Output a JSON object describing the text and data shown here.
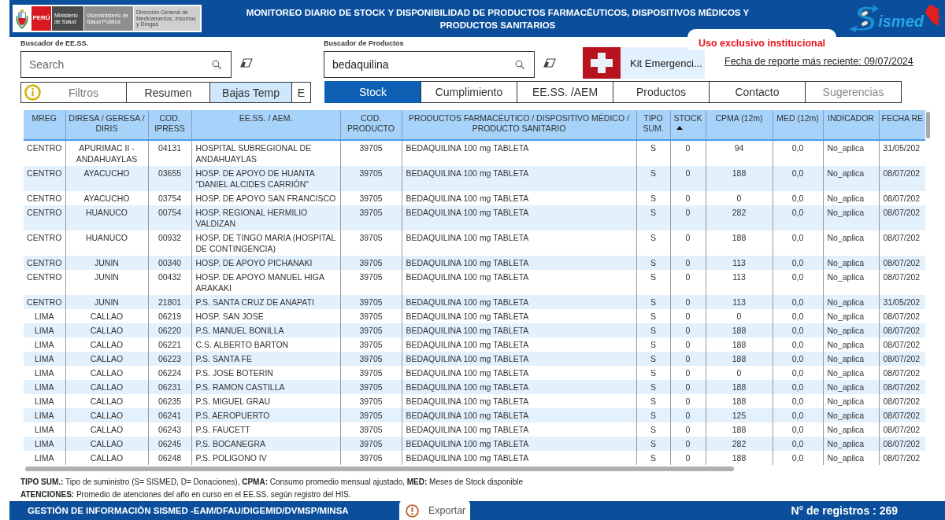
{
  "header": {
    "emblem": {
      "country": "PERÚ",
      "ministry": "Ministerio de Salud",
      "vice_ministry": "Viceministerio de Salud Pública",
      "directorate": "Dirección General de Medicamentos, Insumos y Drogas"
    },
    "title": "MONITOREO DIARIO DE STOCK Y DISPONIBILIDAD DE PRODUCTOS FARMACÉUTICOS, DISPOSITIVOS MÉDICOS Y PRODUCTOS SANITARIOS",
    "brand": "ismed"
  },
  "notice": "Uso exclusivo institucional",
  "facility_search": {
    "label": "Buscador de EE.SS.",
    "placeholder": "Search"
  },
  "product_search": {
    "label": "Buscador de Productos",
    "value": "bedaquilina"
  },
  "kit_button": "Kit Emergenci...",
  "report_date": "Fecha de reporte más reciente: 09/07/2024",
  "side_tabs": [
    {
      "label": "Filtros",
      "kind": "info",
      "selected": false,
      "disabled": true
    },
    {
      "label": "Resumen",
      "kind": "plain",
      "selected": false,
      "disabled": false
    },
    {
      "label": "Bajas Temp",
      "kind": "plain",
      "selected": true,
      "disabled": false
    },
    {
      "label": "E",
      "kind": "plain",
      "selected": false,
      "disabled": false
    }
  ],
  "main_tabs": [
    {
      "label": "Stock",
      "selected": true,
      "disabled": false
    },
    {
      "label": "Cumplimiento",
      "selected": false,
      "disabled": false
    },
    {
      "label": "EE.SS. /AEM",
      "selected": false,
      "disabled": false
    },
    {
      "label": "Productos",
      "selected": false,
      "disabled": false
    },
    {
      "label": "Contacto",
      "selected": false,
      "disabled": false
    },
    {
      "label": "Sugerencias",
      "selected": false,
      "disabled": true
    }
  ],
  "table": {
    "columns": [
      {
        "label": "MREG",
        "sorted": false
      },
      {
        "label": "DIRESA / GERESA / DIRIS",
        "sorted": false
      },
      {
        "label": "COD. IPRESS",
        "sorted": false
      },
      {
        "label": "EE.SS. / AEM.",
        "sorted": false
      },
      {
        "label": "COD. PRODUCTO",
        "sorted": false
      },
      {
        "label": "PRODUCTOS FARMACÉUTICO / DISPOSITIVO MÉDICO / PRODUCTO SANITARIO",
        "sorted": false
      },
      {
        "label": "TIPO SUM.",
        "sorted": false
      },
      {
        "label": "STOCK",
        "sorted": true
      },
      {
        "label": "CPMA (12m)",
        "sorted": false
      },
      {
        "label": "MED (12m)",
        "sorted": false
      },
      {
        "label": "INDICADOR",
        "sorted": false
      },
      {
        "label": "FECHA RE",
        "sorted": false
      }
    ],
    "rows": [
      [
        "CENTRO",
        "APURIMAC II - ANDAHUAYLAS",
        "04131",
        "HOSPITAL SUBREGIONAL DE ANDAHUAYLAS",
        "39705",
        "BEDAQUILINA 100 mg TABLETA",
        "S",
        "0",
        "94",
        "0,0",
        "No_aplica",
        "31/05/202"
      ],
      [
        "CENTRO",
        "AYACUCHO",
        "03655",
        "HOSP. DE APOYO DE HUANTA \"DANIEL ALCIDES CARRIÓN\"",
        "39705",
        "BEDAQUILINA 100 mg TABLETA",
        "S",
        "0",
        "188",
        "0,0",
        "No_aplica",
        "08/07/202"
      ],
      [
        "CENTRO",
        "AYACUCHO",
        "03754",
        "HOSP. DE APOYO SAN FRANCISCO",
        "39705",
        "BEDAQUILINA 100 mg TABLETA",
        "S",
        "0",
        "0",
        "0,0",
        "No_aplica",
        "08/07/202"
      ],
      [
        "CENTRO",
        "HUANUCO",
        "00754",
        "HOSP. REGIONAL HERMILIO VALDIZAN",
        "39705",
        "BEDAQUILINA 100 mg TABLETA",
        "S",
        "0",
        "282",
        "0,0",
        "No_aplica",
        "08/07/202"
      ],
      [
        "CENTRO",
        "HUANUCO",
        "00932",
        "HOSP. DE TINGO MARIA (HOSPITAL DE CONTINGENCIA)",
        "39705",
        "BEDAQUILINA 100 mg TABLETA",
        "S",
        "0",
        "188",
        "0,0",
        "No_aplica",
        "08/07/202"
      ],
      [
        "CENTRO",
        "JUNIN",
        "00340",
        "HOSP. DE APOYO PICHANAKI",
        "39705",
        "BEDAQUILINA 100 mg TABLETA",
        "S",
        "0",
        "113",
        "0,0",
        "No_aplica",
        "08/07/202"
      ],
      [
        "CENTRO",
        "JUNIN",
        "00432",
        "HOSP. DE APOYO MANUEL HIGA ARAKAKI",
        "39705",
        "BEDAQUILINA 100 mg TABLETA",
        "S",
        "0",
        "113",
        "0,0",
        "No_aplica",
        "08/07/202"
      ],
      [
        "CENTRO",
        "JUNIN",
        "21801",
        "P.S. SANTA CRUZ DE ANAPATI",
        "39705",
        "BEDAQUILINA 100 mg TABLETA",
        "S",
        "0",
        "113",
        "0,0",
        "No_aplica",
        "31/05/202"
      ],
      [
        "LIMA",
        "CALLAO",
        "06219",
        "HOSP. SAN JOSE",
        "39705",
        "BEDAQUILINA 100 mg TABLETA",
        "S",
        "0",
        "0",
        "0,0",
        "No_aplica",
        "08/07/202"
      ],
      [
        "LIMA",
        "CALLAO",
        "06220",
        "P.S. MANUEL BONILLA",
        "39705",
        "BEDAQUILINA 100 mg TABLETA",
        "S",
        "0",
        "188",
        "0,0",
        "No_aplica",
        "08/07/202"
      ],
      [
        "LIMA",
        "CALLAO",
        "06221",
        "C.S. ALBERTO BARTON",
        "39705",
        "BEDAQUILINA 100 mg TABLETA",
        "S",
        "0",
        "188",
        "0,0",
        "No_aplica",
        "08/07/202"
      ],
      [
        "LIMA",
        "CALLAO",
        "06223",
        "P.S. SANTA FE",
        "39705",
        "BEDAQUILINA 100 mg TABLETA",
        "S",
        "0",
        "188",
        "0,0",
        "No_aplica",
        "08/07/202"
      ],
      [
        "LIMA",
        "CALLAO",
        "06224",
        "P.S. JOSE BOTERIN",
        "39705",
        "BEDAQUILINA 100 mg TABLETA",
        "S",
        "0",
        "0",
        "0,0",
        "No_aplica",
        "08/07/202"
      ],
      [
        "LIMA",
        "CALLAO",
        "06231",
        "P.S. RAMON CASTILLA",
        "39705",
        "BEDAQUILINA 100 mg TABLETA",
        "S",
        "0",
        "188",
        "0,0",
        "No_aplica",
        "08/07/202"
      ],
      [
        "LIMA",
        "CALLAO",
        "06235",
        "P.S. MIGUEL GRAU",
        "39705",
        "BEDAQUILINA 100 mg TABLETA",
        "S",
        "0",
        "188",
        "0,0",
        "No_aplica",
        "08/07/202"
      ],
      [
        "LIMA",
        "CALLAO",
        "06241",
        "P.S. AEROPUERTO",
        "39705",
        "BEDAQUILINA 100 mg TABLETA",
        "S",
        "0",
        "125",
        "0,0",
        "No_aplica",
        "08/07/202"
      ],
      [
        "LIMA",
        "CALLAO",
        "06243",
        "P.S. FAUCETT",
        "39705",
        "BEDAQUILINA 100 mg TABLETA",
        "S",
        "0",
        "188",
        "0,0",
        "No_aplica",
        "08/07/202"
      ],
      [
        "LIMA",
        "CALLAO",
        "06245",
        "P.S. BOCANEGRA",
        "39705",
        "BEDAQUILINA 100 mg TABLETA",
        "S",
        "0",
        "282",
        "0,0",
        "No_aplica",
        "08/07/202"
      ],
      [
        "LIMA",
        "CALLAO",
        "06248",
        "P.S. POLIGONO IV",
        "39705",
        "BEDAQUILINA 100 mg TABLETA",
        "S",
        "0",
        "188",
        "0,0",
        "No_aplica",
        "08/07/202"
      ]
    ]
  },
  "legend": [
    "**TIPO SUM.:** Tipo de suministro (S= SISMED, D= Donaciones), **CPMA:** Consumo promedio mensual ajustado, **MED:** Meses de Stock disponible",
    "**ATENCIONES:** Promedio de atenciones del año en curso en el EE.SS. según registro del HIS."
  ],
  "footer": {
    "credit": "GESTIÓN DE INFORMACIÓN SISMED -EAM/DFAU/DIGEMID/DVMSP/MINSA",
    "export_button": "Exportar",
    "record_count": "N° de registros : 269"
  }
}
